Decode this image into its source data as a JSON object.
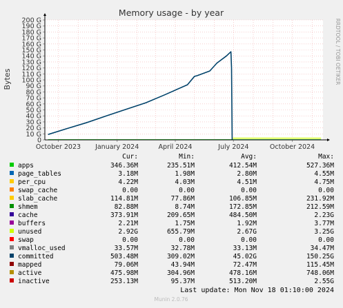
{
  "chart_data": {
    "type": "line",
    "title": "Memory usage - by year",
    "ylabel": "Bytes",
    "side_label": "RRDTOOL / TOBI OETIKER",
    "ylim": [
      0,
      200
    ],
    "yunit": "G",
    "yticks": [
      0,
      10,
      20,
      30,
      40,
      50,
      60,
      70,
      80,
      90,
      100,
      110,
      120,
      130,
      140,
      150,
      160,
      170,
      180,
      190,
      200
    ],
    "ytick_labels": [
      "0",
      "10 G",
      "20 G",
      "30 G",
      "40 G",
      "50 G",
      "60 G",
      "70 G",
      "80 G",
      "90 G",
      "100 G",
      "110 G",
      "120 G",
      "130 G",
      "140 G",
      "150 G",
      "160 G",
      "170 G",
      "180 G",
      "190 G",
      "200 G"
    ],
    "xrange": [
      "2023-09-10",
      "2024-11-18"
    ],
    "xticks": [
      {
        "date": "2023-10-01",
        "label": "October 2023"
      },
      {
        "date": "2024-01-01",
        "label": "January 2024"
      },
      {
        "date": "2024-04-01",
        "label": "April 2024"
      },
      {
        "date": "2024-07-01",
        "label": "July 2024"
      },
      {
        "date": "2024-10-01",
        "label": "October 2024"
      }
    ],
    "series": [
      {
        "name": "committed",
        "color": "#00426a",
        "points": [
          [
            "2023-09-15",
            9
          ],
          [
            "2023-10-15",
            19
          ],
          [
            "2023-11-15",
            29
          ],
          [
            "2023-12-15",
            40
          ],
          [
            "2024-01-15",
            51
          ],
          [
            "2024-02-15",
            62
          ],
          [
            "2024-03-15",
            75
          ],
          [
            "2024-04-20",
            92
          ],
          [
            "2024-05-01",
            106
          ],
          [
            "2024-05-05",
            107
          ],
          [
            "2024-05-25",
            115
          ],
          [
            "2024-06-05",
            128
          ],
          [
            "2024-06-20",
            140
          ],
          [
            "2024-06-27",
            147
          ],
          [
            "2024-06-28",
            120
          ],
          [
            "2024-06-29",
            0
          ]
        ]
      },
      {
        "name": "unused",
        "color": "#ccff00",
        "points": [
          [
            "2024-06-29",
            2.9
          ],
          [
            "2024-11-15",
            2.9
          ]
        ]
      },
      {
        "name": "apps",
        "color": "#00cc00",
        "points": [
          [
            "2023-09-15",
            0.35
          ],
          [
            "2024-11-15",
            0.35
          ]
        ]
      }
    ],
    "legend": {
      "columns": [
        "Cur:",
        "Min:",
        "Avg:",
        "Max:"
      ],
      "rows": [
        {
          "name": "apps",
          "color": "#00cc00",
          "values": [
            "346.36M",
            "235.51M",
            "412.54M",
            "527.36M"
          ]
        },
        {
          "name": "page_tables",
          "color": "#0066b3",
          "values": [
            "3.18M",
            "1.98M",
            "2.80M",
            "4.55M"
          ]
        },
        {
          "name": "per_cpu",
          "color": "#ffcc00",
          "values": [
            "4.22M",
            "4.03M",
            "4.51M",
            "4.75M"
          ]
        },
        {
          "name": "swap_cache",
          "color": "#ff8000",
          "values": [
            "0.00",
            "0.00",
            "0.00",
            "0.00"
          ]
        },
        {
          "name": "slab_cache",
          "color": "#ffcc00",
          "values": [
            "114.81M",
            "77.86M",
            "106.85M",
            "231.92M"
          ]
        },
        {
          "name": "shmem",
          "color": "#008f00",
          "values": [
            "82.88M",
            "8.74M",
            "172.85M",
            "212.59M"
          ]
        },
        {
          "name": "cache",
          "color": "#330099",
          "values": [
            "373.91M",
            "209.65M",
            "484.50M",
            "2.23G"
          ]
        },
        {
          "name": "buffers",
          "color": "#990099",
          "values": [
            "2.21M",
            "1.75M",
            "1.92M",
            "3.77M"
          ]
        },
        {
          "name": "unused",
          "color": "#ccff00",
          "values": [
            "2.92G",
            "655.79M",
            "2.67G",
            "3.25G"
          ]
        },
        {
          "name": "swap",
          "color": "#ff0000",
          "values": [
            "0.00",
            "0.00",
            "0.00",
            "0.00"
          ]
        },
        {
          "name": "vmalloc_used",
          "color": "#808080",
          "values": [
            "33.57M",
            "32.78M",
            "33.13M",
            "34.47M"
          ]
        },
        {
          "name": "committed",
          "color": "#00426a",
          "values": [
            "503.48M",
            "309.02M",
            "45.02G",
            "150.25G"
          ]
        },
        {
          "name": "mapped",
          "color": "#8f0000",
          "values": [
            "79.06M",
            "43.94M",
            "72.47M",
            "115.45M"
          ]
        },
        {
          "name": "active",
          "color": "#b38f00",
          "values": [
            "475.98M",
            "304.96M",
            "478.16M",
            "748.06M"
          ]
        },
        {
          "name": "inactive",
          "color": "#cc0000",
          "values": [
            "253.13M",
            "95.37M",
            "513.20M",
            "2.55G"
          ]
        }
      ]
    },
    "last_update": "Last update: Mon Nov 18 01:10:00 2024",
    "footer": "Munin 2.0.76"
  }
}
